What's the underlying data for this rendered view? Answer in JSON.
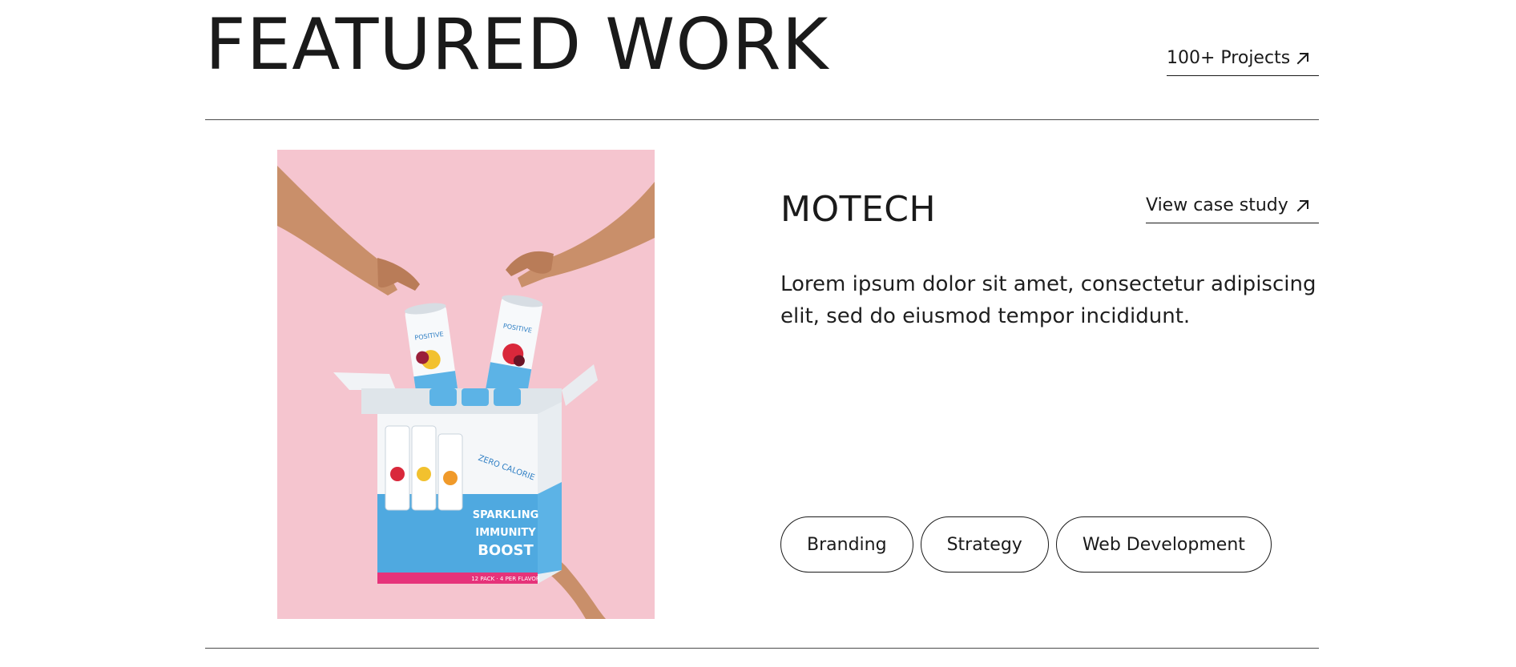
{
  "header": {
    "title": "FEATURED WORK",
    "projects_link_label": "100+ Projects",
    "projects_link_icon": "arrow-up-right-icon"
  },
  "project": {
    "name": "MOTECH",
    "case_study_label": "View case study",
    "case_study_icon": "arrow-up-right-icon",
    "description": "Lorem ipsum dolor sit amet, consectetur adipiscing elit, sed do eiusmod tempor incididunt.",
    "image": {
      "background_color": "#f5c5cf",
      "brand_label": "POSITIVE",
      "box_text_1": "SPARKLING",
      "box_text_2": "IMMUNITY BOOST",
      "box_text_3": "ZERO CALORIE",
      "box_text_4": "12 PACK · 4 PER FLAVOR"
    },
    "tags": [
      "Branding",
      "Strategy",
      "Web Development"
    ]
  },
  "colors": {
    "text": "#1a1a1a",
    "divider": "#4a4a4a",
    "image_bg": "#f5c5cf",
    "box_blue": "#4fa9e0",
    "box_magenta": "#e6337a"
  }
}
